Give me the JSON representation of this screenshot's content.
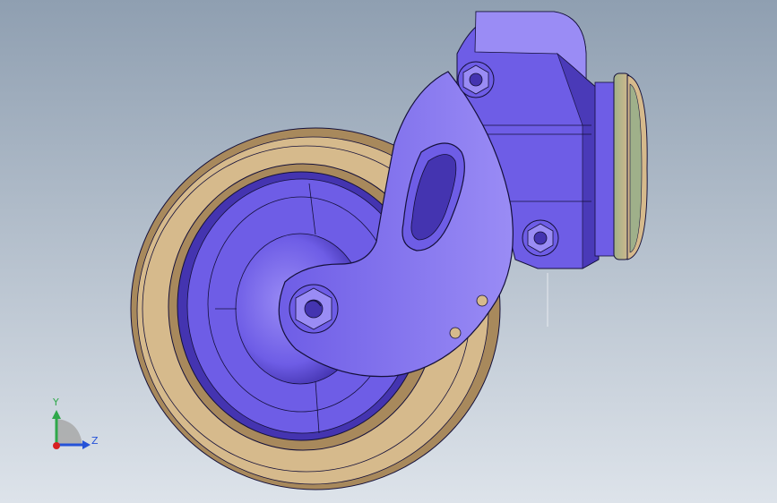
{
  "colors": {
    "background_top": "#8f9fb1",
    "background_bottom": "#dde3ea",
    "body_main": "#6e5de6",
    "body_light": "#9a8cf5",
    "body_dark": "#4434b0",
    "tire_main": "#d6ba8c",
    "tire_dark": "#a8895c",
    "washer_green": "#9fb08a",
    "edge_line": "#14103a",
    "axis_y": "#2fa84a",
    "axis_z": "#2552d8",
    "axis_origin": "#d82020"
  },
  "triad": {
    "y_label": "Y",
    "z_label": "Z"
  }
}
